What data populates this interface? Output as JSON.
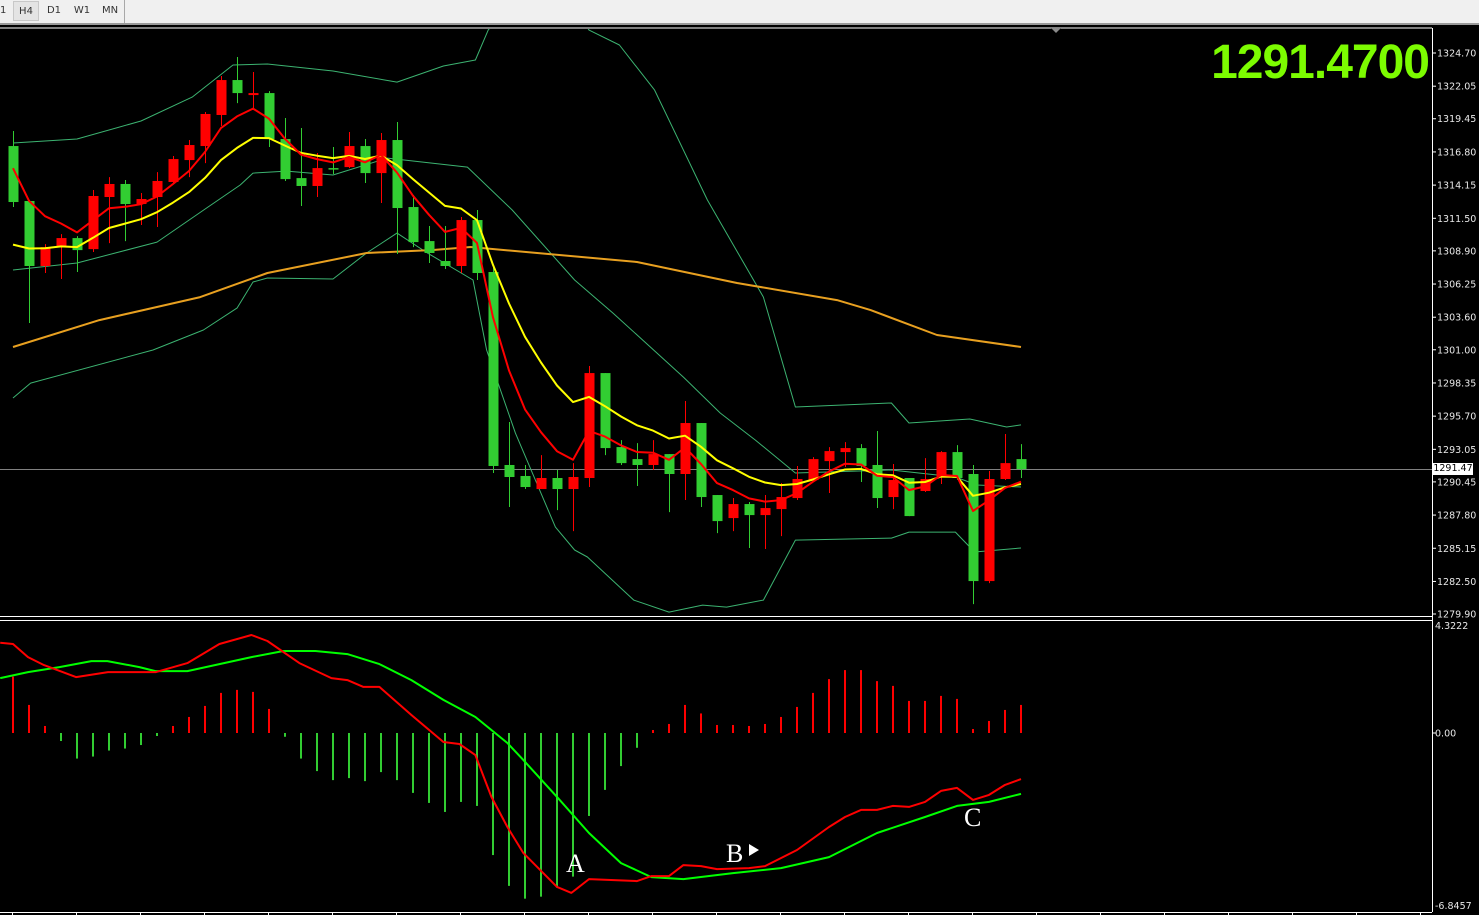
{
  "toolbar": {
    "timeframes": [
      {
        "label": "1"
      },
      {
        "label": "H4",
        "active": true
      },
      {
        "label": "D1"
      },
      {
        "label": "W1"
      },
      {
        "label": "MN"
      }
    ]
  },
  "chart": {
    "current_price_big": "1291.4700",
    "current_price_label": "1291.47",
    "price_axis_labels": [
      "1324.70",
      "1322.05",
      "1319.45",
      "1316.80",
      "1314.15",
      "1311.50",
      "1308.90",
      "1306.25",
      "1303.60",
      "1301.00",
      "1298.35",
      "1295.70",
      "1293.05",
      "1290.45",
      "1287.80",
      "1285.15",
      "1282.50",
      "1279.90"
    ],
    "macd_axis_labels": [
      "4.3222",
      "0.00",
      "-6.8457"
    ],
    "annotations": [
      "A",
      "B",
      "C"
    ],
    "colors": {
      "background": "#000000",
      "bull_candle": "#ff0000",
      "bear_candle": "#32cd32",
      "fast_ma": "#ff0000",
      "slow_ma": "#ffff00",
      "long_ma": "#e8a020",
      "bands": "#3cb371",
      "big_price": "#7cfc00",
      "macd_line": "#ff0000",
      "signal_line": "#00ff00",
      "hist_pos": "#ff0000",
      "hist_neg": "#32cd32"
    }
  },
  "chart_data": {
    "type": "candlestick",
    "timeframe": "H4",
    "ylim": [
      1279.9,
      1324.7
    ],
    "current_price": 1291.47,
    "candles_ohlc": [
      [
        1317.27,
        1318.47,
        1312.4,
        1312.8
      ],
      [
        1312.88,
        1312.96,
        1303.14,
        1307.69
      ],
      [
        1307.69,
        1309.44,
        1307.13,
        1309.2
      ],
      [
        1309.2,
        1310.24,
        1306.65,
        1309.92
      ],
      [
        1309.92,
        1310.08,
        1307.21,
        1308.96
      ],
      [
        1309.04,
        1313.76,
        1308.81,
        1313.28
      ],
      [
        1313.2,
        1314.79,
        1309.52,
        1314.24
      ],
      [
        1314.24,
        1314.56,
        1309.68,
        1312.64
      ],
      [
        1312.64,
        1313.52,
        1310.96,
        1313.04
      ],
      [
        1313.2,
        1315.19,
        1310.8,
        1314.48
      ],
      [
        1314.4,
        1316.47,
        1314.32,
        1316.23
      ],
      [
        1316.15,
        1317.75,
        1314.79,
        1317.35
      ],
      [
        1317.27,
        1319.99,
        1315.91,
        1319.83
      ],
      [
        1319.75,
        1322.86,
        1318.87,
        1322.54
      ],
      [
        1322.54,
        1324.38,
        1320.7,
        1321.5
      ],
      [
        1321.34,
        1323.18,
        1320.15,
        1321.5
      ],
      [
        1321.5,
        1321.66,
        1317.19,
        1317.83
      ],
      [
        1317.83,
        1319.51,
        1314.48,
        1314.63
      ],
      [
        1314.71,
        1318.71,
        1312.48,
        1314.08
      ],
      [
        1314.08,
        1316.71,
        1313.2,
        1315.51
      ],
      [
        1315.51,
        1317.19,
        1315.03,
        1315.43
      ],
      [
        1315.59,
        1318.39,
        1315.51,
        1317.27
      ],
      [
        1317.27,
        1317.83,
        1314.32,
        1315.11
      ],
      [
        1315.11,
        1318.31,
        1312.72,
        1317.75
      ],
      [
        1317.75,
        1319.19,
        1308.65,
        1312.32
      ],
      [
        1312.4,
        1313.36,
        1309.2,
        1309.6
      ],
      [
        1309.68,
        1310.88,
        1307.93,
        1308.73
      ],
      [
        1308.09,
        1310.88,
        1307.45,
        1307.69
      ],
      [
        1307.69,
        1311.6,
        1307.13,
        1311.36
      ],
      [
        1311.36,
        1312.16,
        1306.57,
        1307.13
      ],
      [
        1307.21,
        1307.61,
        1291.16,
        1291.72
      ],
      [
        1291.8,
        1295.23,
        1288.44,
        1290.84
      ],
      [
        1290.92,
        1291.8,
        1289.88,
        1290.04
      ],
      [
        1289.88,
        1292.59,
        1289.88,
        1290.76
      ],
      [
        1290.76,
        1291.4,
        1288.2,
        1289.88
      ],
      [
        1289.88,
        1291.95,
        1286.52,
        1290.84
      ],
      [
        1290.76,
        1299.7,
        1290.04,
        1299.14
      ],
      [
        1299.14,
        1299.14,
        1292.59,
        1293.15
      ],
      [
        1293.23,
        1293.79,
        1291.8,
        1291.95
      ],
      [
        1292.27,
        1293.55,
        1290.12,
        1291.8
      ],
      [
        1291.8,
        1293.79,
        1291.4,
        1292.67
      ],
      [
        1292.67,
        1292.67,
        1288.04,
        1291.08
      ],
      [
        1291.08,
        1296.91,
        1289.0,
        1295.15
      ],
      [
        1295.15,
        1295.15,
        1288.44,
        1289.24
      ],
      [
        1289.4,
        1289.4,
        1286.36,
        1287.32
      ],
      [
        1287.56,
        1289.16,
        1286.52,
        1288.68
      ],
      [
        1288.68,
        1288.84,
        1285.17,
        1287.8
      ],
      [
        1287.8,
        1289.4,
        1285.09,
        1288.36
      ],
      [
        1288.28,
        1290.36,
        1286.12,
        1289.24
      ],
      [
        1289.16,
        1291.72,
        1289.0,
        1290.68
      ],
      [
        1290.6,
        1292.43,
        1290.44,
        1292.27
      ],
      [
        1292.11,
        1293.23,
        1289.56,
        1292.91
      ],
      [
        1292.83,
        1293.63,
        1291.64,
        1293.15
      ],
      [
        1293.15,
        1293.47,
        1290.44,
        1291.72
      ],
      [
        1291.8,
        1294.51,
        1288.36,
        1289.16
      ],
      [
        1289.24,
        1291.88,
        1288.28,
        1290.6
      ],
      [
        1290.76,
        1290.76,
        1287.72,
        1287.72
      ],
      [
        1289.72,
        1292.35,
        1289.64,
        1290.68
      ],
      [
        1290.84,
        1292.91,
        1290.28,
        1292.83
      ],
      [
        1292.83,
        1293.39,
        1290.6,
        1290.76
      ],
      [
        1291.08,
        1291.8,
        1280.69,
        1282.53
      ],
      [
        1282.53,
        1291.32,
        1282.37,
        1290.68
      ],
      [
        1290.68,
        1294.27,
        1290.6,
        1291.95
      ],
      [
        1292.27,
        1293.47,
        1290.76,
        1291.47
      ]
    ],
    "fast_ma": {
      "type": "EMA",
      "period": 5,
      "seed": 1315.5
    },
    "slow_ma": {
      "type": "EMA",
      "period": 10,
      "seed": 1309.4
    },
    "long_ma_points": [
      [
        0,
        1301.22
      ],
      [
        5.4,
        1303.37
      ],
      [
        11.7,
        1305.21
      ],
      [
        15.9,
        1307.13
      ],
      [
        22.1,
        1308.73
      ],
      [
        26.25,
        1308.97
      ],
      [
        28.6,
        1309.21
      ],
      [
        39,
        1308.01
      ],
      [
        45.25,
        1306.33
      ],
      [
        51.5,
        1304.97
      ],
      [
        53.6,
        1304.17
      ],
      [
        57.75,
        1302.18
      ],
      [
        63,
        1301.22
      ]
    ],
    "band_upper_points": [
      [
        0,
        1317.51
      ],
      [
        4,
        1317.83
      ],
      [
        8,
        1319.27
      ],
      [
        11.2,
        1321.18
      ],
      [
        13.75,
        1323.74
      ],
      [
        15.9,
        1323.82
      ],
      [
        20,
        1323.26
      ],
      [
        24,
        1322.38
      ],
      [
        26.9,
        1323.66
      ],
      [
        28.9,
        1324.14
      ],
      [
        29.7,
        1326.53
      ],
      [
        32,
        1330.5
      ],
      [
        34,
        1331.0
      ],
      [
        36,
        1326.53
      ],
      [
        37.9,
        1325.34
      ],
      [
        40.1,
        1321.74
      ],
      [
        43.4,
        1312.96
      ],
      [
        46.9,
        1305.21
      ],
      [
        48.9,
        1296.43
      ],
      [
        54.9,
        1296.75
      ],
      [
        56,
        1295.15
      ],
      [
        59.8,
        1295.47
      ],
      [
        62.1,
        1294.83
      ],
      [
        63,
        1295.0
      ]
    ],
    "band_middle_points": [
      [
        0,
        1307.37
      ],
      [
        4,
        1307.93
      ],
      [
        9,
        1309.6
      ],
      [
        12.1,
        1312.32
      ],
      [
        14.2,
        1314.16
      ],
      [
        15,
        1315.11
      ],
      [
        17.1,
        1315.27
      ],
      [
        20,
        1314.96
      ],
      [
        23.4,
        1316.31
      ],
      [
        28.4,
        1315.59
      ],
      [
        31.2,
        1312.16
      ],
      [
        35.1,
        1306.57
      ],
      [
        37.5,
        1303.93
      ],
      [
        41.9,
        1298.82
      ],
      [
        44.2,
        1295.95
      ],
      [
        46.4,
        1293.79
      ],
      [
        48.9,
        1291.16
      ],
      [
        50.9,
        1291.24
      ],
      [
        54.9,
        1291.4
      ],
      [
        58.9,
        1290.84
      ],
      [
        60.25,
        1290.2
      ],
      [
        63,
        1290.04
      ]
    ],
    "band_lower_points": [
      [
        0,
        1297.15
      ],
      [
        1.1,
        1298.34
      ],
      [
        8.75,
        1300.98
      ],
      [
        11.9,
        1302.58
      ],
      [
        14,
        1304.33
      ],
      [
        15,
        1306.41
      ],
      [
        15.9,
        1306.73
      ],
      [
        20,
        1306.65
      ],
      [
        22.1,
        1308.73
      ],
      [
        24,
        1310.32
      ],
      [
        25.9,
        1308.73
      ],
      [
        28.75,
        1306.57
      ],
      [
        29.6,
        1300.98
      ],
      [
        31.4,
        1294.35
      ],
      [
        33.9,
        1286.84
      ],
      [
        35.1,
        1285.01
      ],
      [
        35.9,
        1284.45
      ],
      [
        38.8,
        1281.01
      ],
      [
        41,
        1280.05
      ],
      [
        43.1,
        1280.61
      ],
      [
        44.6,
        1280.45
      ],
      [
        46.9,
        1281.01
      ],
      [
        48.9,
        1285.8
      ],
      [
        54.9,
        1285.96
      ],
      [
        56,
        1286.44
      ],
      [
        58.9,
        1286.44
      ],
      [
        60.1,
        1284.85
      ],
      [
        63,
        1285.17
      ]
    ],
    "macd": {
      "ylim": [
        -6.8457,
        4.3222
      ],
      "histogram": [
        2.25,
        1.12,
        0.28,
        -0.32,
        -1.02,
        -0.94,
        -0.7,
        -0.62,
        -0.48,
        -0.12,
        0.28,
        0.64,
        1.08,
        1.6,
        1.72,
        1.64,
        0.96,
        -0.15,
        -1.02,
        -1.52,
        -1.88,
        -1.8,
        -1.92,
        -1.56,
        -1.88,
        -2.39,
        -2.79,
        -3.15,
        -2.75,
        -2.91,
        -4.87,
        -6.1,
        -6.61,
        -6.53,
        -6.17,
        -5.73,
        -3.31,
        -2.27,
        -1.32,
        -0.59,
        0.12,
        0.36,
        1.12,
        0.78,
        0.32,
        0.32,
        0.28,
        0.36,
        0.64,
        1.04,
        1.6,
        2.15,
        2.51,
        2.51,
        2.07,
        1.88,
        1.28,
        1.28,
        1.48,
        1.36,
        0.16,
        0.48,
        0.92,
        1.12
      ],
      "macd_line_points": [
        [
          -0.8,
          3.6
        ],
        [
          0,
          3.55
        ],
        [
          0.94,
          3.03
        ],
        [
          1.94,
          2.71
        ],
        [
          3.94,
          2.23
        ],
        [
          5.94,
          2.43
        ],
        [
          8.94,
          2.43
        ],
        [
          10.9,
          2.79
        ],
        [
          12.9,
          3.55
        ],
        [
          14.9,
          3.91
        ],
        [
          15.9,
          3.67
        ],
        [
          17.9,
          2.79
        ],
        [
          19.9,
          2.19
        ],
        [
          20.9,
          2.11
        ],
        [
          21.9,
          1.84
        ],
        [
          22.9,
          1.84
        ],
        [
          24.9,
          0.72
        ],
        [
          26.9,
          -0.36
        ],
        [
          27.9,
          -0.44
        ],
        [
          28.9,
          -0.88
        ],
        [
          29.9,
          -2.55
        ],
        [
          30.9,
          -3.75
        ],
        [
          31.9,
          -4.79
        ],
        [
          34,
          -6.14
        ],
        [
          34.9,
          -6.38
        ],
        [
          36,
          -5.83
        ],
        [
          39,
          -5.91
        ],
        [
          39.9,
          -5.71
        ],
        [
          41,
          -5.71
        ],
        [
          41.9,
          -5.27
        ],
        [
          43,
          -5.31
        ],
        [
          44,
          -5.43
        ],
        [
          46,
          -5.39
        ],
        [
          47,
          -5.31
        ],
        [
          49,
          -4.67
        ],
        [
          51,
          -3.75
        ],
        [
          52,
          -3.35
        ],
        [
          53,
          -3.07
        ],
        [
          54,
          -3.07
        ],
        [
          55,
          -2.91
        ],
        [
          56,
          -2.95
        ],
        [
          57,
          -2.75
        ],
        [
          58,
          -2.31
        ],
        [
          59,
          -2.19
        ],
        [
          60,
          -2.67
        ],
        [
          61,
          -2.47
        ],
        [
          62,
          -2.07
        ],
        [
          63,
          -1.84
        ]
      ],
      "signal_line_points": [
        [
          -0.8,
          2.19
        ],
        [
          0.94,
          2.43
        ],
        [
          2.9,
          2.63
        ],
        [
          4.9,
          2.87
        ],
        [
          5.9,
          2.87
        ],
        [
          7.9,
          2.63
        ],
        [
          8.9,
          2.47
        ],
        [
          10.9,
          2.47
        ],
        [
          12.9,
          2.75
        ],
        [
          14.9,
          3.03
        ],
        [
          16.9,
          3.27
        ],
        [
          18.9,
          3.27
        ],
        [
          20.9,
          3.15
        ],
        [
          22.9,
          2.75
        ],
        [
          24.9,
          2.11
        ],
        [
          26.9,
          1.32
        ],
        [
          28.9,
          0.64
        ],
        [
          30.9,
          -0.4
        ],
        [
          31.9,
          -1.08
        ],
        [
          34,
          -2.55
        ],
        [
          36,
          -3.99
        ],
        [
          38,
          -5.19
        ],
        [
          39.9,
          -5.75
        ],
        [
          41.9,
          -5.83
        ],
        [
          45,
          -5.59
        ],
        [
          48,
          -5.39
        ],
        [
          51,
          -4.95
        ],
        [
          54,
          -3.99
        ],
        [
          57,
          -3.35
        ],
        [
          59,
          -2.91
        ],
        [
          61,
          -2.75
        ],
        [
          63,
          -2.43
        ]
      ]
    }
  }
}
